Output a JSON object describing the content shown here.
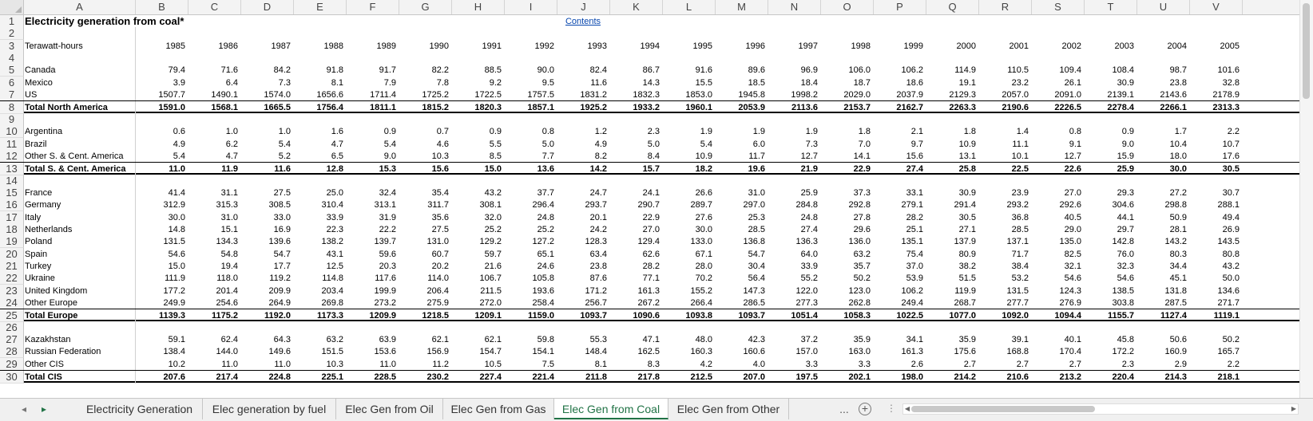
{
  "columns": [
    "A",
    "B",
    "C",
    "D",
    "E",
    "F",
    "G",
    "H",
    "I",
    "J",
    "K",
    "L",
    "M",
    "N",
    "O",
    "P",
    "Q",
    "R",
    "S",
    "T",
    "U",
    "V"
  ],
  "title": "Electricity generation from coal*",
  "contents_link": "Contents",
  "unit_label": "Terawatt-hours",
  "years": [
    "1985",
    "1986",
    "1987",
    "1988",
    "1989",
    "1990",
    "1991",
    "1992",
    "1993",
    "1994",
    "1995",
    "1996",
    "1997",
    "1998",
    "1999",
    "2000",
    "2001",
    "2002",
    "2003",
    "2004",
    "2005"
  ],
  "rows": [
    {
      "n": "5",
      "label": "Canada",
      "values": [
        "79.4",
        "71.6",
        "84.2",
        "91.8",
        "91.7",
        "82.2",
        "88.5",
        "90.0",
        "82.4",
        "86.7",
        "91.6",
        "89.6",
        "96.9",
        "106.0",
        "106.2",
        "114.9",
        "110.5",
        "109.4",
        "108.4",
        "98.7",
        "101.6"
      ]
    },
    {
      "n": "6",
      "label": "Mexico",
      "values": [
        "3.9",
        "6.4",
        "7.3",
        "8.1",
        "7.9",
        "7.8",
        "9.2",
        "9.5",
        "11.6",
        "14.3",
        "15.5",
        "18.5",
        "18.4",
        "18.7",
        "18.6",
        "19.1",
        "23.2",
        "26.1",
        "30.9",
        "23.8",
        "32.8"
      ]
    },
    {
      "n": "7",
      "label": "US",
      "values": [
        "1507.7",
        "1490.1",
        "1574.0",
        "1656.6",
        "1711.4",
        "1725.2",
        "1722.5",
        "1757.5",
        "1831.2",
        "1832.3",
        "1853.0",
        "1945.8",
        "1998.2",
        "2029.0",
        "2037.9",
        "2129.3",
        "2057.0",
        "2091.0",
        "2139.1",
        "2143.6",
        "2178.9"
      ]
    },
    {
      "n": "8",
      "label": "Total North America",
      "bold": true,
      "values": [
        "1591.0",
        "1568.1",
        "1665.5",
        "1756.4",
        "1811.1",
        "1815.2",
        "1820.3",
        "1857.1",
        "1925.2",
        "1933.2",
        "1960.1",
        "2053.9",
        "2113.6",
        "2153.7",
        "2162.7",
        "2263.3",
        "2190.6",
        "2226.5",
        "2278.4",
        "2266.1",
        "2313.3"
      ]
    },
    {
      "n": "10",
      "label": "Argentina",
      "values": [
        "0.6",
        "1.0",
        "1.0",
        "1.6",
        "0.9",
        "0.7",
        "0.9",
        "0.8",
        "1.2",
        "2.3",
        "1.9",
        "1.9",
        "1.9",
        "1.8",
        "2.1",
        "1.8",
        "1.4",
        "0.8",
        "0.9",
        "1.7",
        "2.2"
      ]
    },
    {
      "n": "11",
      "label": "Brazil",
      "values": [
        "4.9",
        "6.2",
        "5.4",
        "4.7",
        "5.4",
        "4.6",
        "5.5",
        "5.0",
        "4.9",
        "5.0",
        "5.4",
        "6.0",
        "7.3",
        "7.0",
        "9.7",
        "10.9",
        "11.1",
        "9.1",
        "9.0",
        "10.4",
        "10.7"
      ]
    },
    {
      "n": "12",
      "label": "Other S. & Cent. America",
      "values": [
        "5.4",
        "4.7",
        "5.2",
        "6.5",
        "9.0",
        "10.3",
        "8.5",
        "7.7",
        "8.2",
        "8.4",
        "10.9",
        "11.7",
        "12.7",
        "14.1",
        "15.6",
        "13.1",
        "10.1",
        "12.7",
        "15.9",
        "18.0",
        "17.6"
      ]
    },
    {
      "n": "13",
      "label": "Total S. & Cent. America",
      "bold": true,
      "values": [
        "11.0",
        "11.9",
        "11.6",
        "12.8",
        "15.3",
        "15.6",
        "15.0",
        "13.6",
        "14.2",
        "15.7",
        "18.2",
        "19.6",
        "21.9",
        "22.9",
        "27.4",
        "25.8",
        "22.5",
        "22.6",
        "25.9",
        "30.0",
        "30.5"
      ]
    },
    {
      "n": "15",
      "label": "France",
      "values": [
        "41.4",
        "31.1",
        "27.5",
        "25.0",
        "32.4",
        "35.4",
        "43.2",
        "37.7",
        "24.7",
        "24.1",
        "26.6",
        "31.0",
        "25.9",
        "37.3",
        "33.1",
        "30.9",
        "23.9",
        "27.0",
        "29.3",
        "27.2",
        "30.7"
      ]
    },
    {
      "n": "16",
      "label": "Germany",
      "values": [
        "312.9",
        "315.3",
        "308.5",
        "310.4",
        "313.1",
        "311.7",
        "308.1",
        "296.4",
        "293.7",
        "290.7",
        "289.7",
        "297.0",
        "284.8",
        "292.8",
        "279.1",
        "291.4",
        "293.2",
        "292.6",
        "304.6",
        "298.8",
        "288.1"
      ]
    },
    {
      "n": "17",
      "label": "Italy",
      "values": [
        "30.0",
        "31.0",
        "33.0",
        "33.9",
        "31.9",
        "35.6",
        "32.0",
        "24.8",
        "20.1",
        "22.9",
        "27.6",
        "25.3",
        "24.8",
        "27.8",
        "28.2",
        "30.5",
        "36.8",
        "40.5",
        "44.1",
        "50.9",
        "49.4"
      ]
    },
    {
      "n": "18",
      "label": "Netherlands",
      "values": [
        "14.8",
        "15.1",
        "16.9",
        "22.3",
        "22.2",
        "27.5",
        "25.2",
        "25.2",
        "24.2",
        "27.0",
        "30.0",
        "28.5",
        "27.4",
        "29.6",
        "25.1",
        "27.1",
        "28.5",
        "29.0",
        "29.7",
        "28.1",
        "26.9"
      ]
    },
    {
      "n": "19",
      "label": "Poland",
      "values": [
        "131.5",
        "134.3",
        "139.6",
        "138.2",
        "139.7",
        "131.0",
        "129.2",
        "127.2",
        "128.3",
        "129.4",
        "133.0",
        "136.8",
        "136.3",
        "136.0",
        "135.1",
        "137.9",
        "137.1",
        "135.0",
        "142.8",
        "143.2",
        "143.5"
      ]
    },
    {
      "n": "20",
      "label": "Spain",
      "values": [
        "54.6",
        "54.8",
        "54.7",
        "43.1",
        "59.6",
        "60.7",
        "59.7",
        "65.1",
        "63.4",
        "62.6",
        "67.1",
        "54.7",
        "64.0",
        "63.2",
        "75.4",
        "80.9",
        "71.7",
        "82.5",
        "76.0",
        "80.3",
        "80.8"
      ]
    },
    {
      "n": "21",
      "label": "Turkey",
      "values": [
        "15.0",
        "19.4",
        "17.7",
        "12.5",
        "20.3",
        "20.2",
        "21.6",
        "24.6",
        "23.8",
        "28.2",
        "28.0",
        "30.4",
        "33.9",
        "35.7",
        "37.0",
        "38.2",
        "38.4",
        "32.1",
        "32.3",
        "34.4",
        "43.2"
      ]
    },
    {
      "n": "22",
      "label": "Ukraine",
      "values": [
        "111.9",
        "118.0",
        "119.2",
        "114.8",
        "117.6",
        "114.0",
        "106.7",
        "105.8",
        "87.6",
        "77.1",
        "70.2",
        "56.4",
        "55.2",
        "50.2",
        "53.9",
        "51.5",
        "53.2",
        "54.6",
        "54.6",
        "45.1",
        "50.0"
      ]
    },
    {
      "n": "23",
      "label": "United Kingdom",
      "values": [
        "177.2",
        "201.4",
        "209.9",
        "203.4",
        "199.9",
        "206.4",
        "211.5",
        "193.6",
        "171.2",
        "161.3",
        "155.2",
        "147.3",
        "122.0",
        "123.0",
        "106.2",
        "119.9",
        "131.5",
        "124.3",
        "138.5",
        "131.8",
        "134.6"
      ]
    },
    {
      "n": "24",
      "label": "Other Europe",
      "values": [
        "249.9",
        "254.6",
        "264.9",
        "269.8",
        "273.2",
        "275.9",
        "272.0",
        "258.4",
        "256.7",
        "267.2",
        "266.4",
        "286.5",
        "277.3",
        "262.8",
        "249.4",
        "268.7",
        "277.7",
        "276.9",
        "303.8",
        "287.5",
        "271.7"
      ]
    },
    {
      "n": "25",
      "label": "Total Europe",
      "bold": true,
      "values": [
        "1139.3",
        "1175.2",
        "1192.0",
        "1173.3",
        "1209.9",
        "1218.5",
        "1209.1",
        "1159.0",
        "1093.7",
        "1090.6",
        "1093.8",
        "1093.7",
        "1051.4",
        "1058.3",
        "1022.5",
        "1077.0",
        "1092.0",
        "1094.4",
        "1155.7",
        "1127.4",
        "1119.1"
      ]
    },
    {
      "n": "27",
      "label": "Kazakhstan",
      "values": [
        "59.1",
        "62.4",
        "64.3",
        "63.2",
        "63.9",
        "62.1",
        "62.1",
        "59.8",
        "55.3",
        "47.1",
        "48.0",
        "42.3",
        "37.2",
        "35.9",
        "34.1",
        "35.9",
        "39.1",
        "40.1",
        "45.8",
        "50.6",
        "50.2"
      ]
    },
    {
      "n": "28",
      "label": "Russian Federation",
      "values": [
        "138.4",
        "144.0",
        "149.6",
        "151.5",
        "153.6",
        "156.9",
        "154.7",
        "154.1",
        "148.4",
        "162.5",
        "160.3",
        "160.6",
        "157.0",
        "163.0",
        "161.3",
        "175.6",
        "168.8",
        "170.4",
        "172.2",
        "160.9",
        "165.7"
      ]
    },
    {
      "n": "29",
      "label": "Other CIS",
      "values": [
        "10.2",
        "11.0",
        "11.0",
        "10.3",
        "11.0",
        "11.2",
        "10.5",
        "7.5",
        "8.1",
        "8.3",
        "4.2",
        "4.0",
        "3.3",
        "3.3",
        "2.6",
        "2.7",
        "2.7",
        "2.7",
        "2.3",
        "2.9",
        "2.2"
      ]
    },
    {
      "n": "30",
      "label": "Total CIS",
      "bold": true,
      "values": [
        "207.6",
        "217.4",
        "224.8",
        "225.1",
        "228.5",
        "230.2",
        "227.4",
        "221.4",
        "211.8",
        "217.8",
        "212.5",
        "207.0",
        "197.5",
        "202.1",
        "198.0",
        "214.2",
        "210.6",
        "213.2",
        "220.4",
        "214.3",
        "218.1"
      ]
    }
  ],
  "empty_rows": [
    "2",
    "4",
    "9",
    "14",
    "26"
  ],
  "tabs": [
    "Electricity Generation",
    "Elec generation by fuel",
    "Elec Gen from Oil",
    "Elec Gen from Gas",
    "Elec Gen from Coal",
    "Elec Gen from Other"
  ],
  "active_tab": "Elec Gen from Coal",
  "more_tabs": "...",
  "add_sheet": "+"
}
